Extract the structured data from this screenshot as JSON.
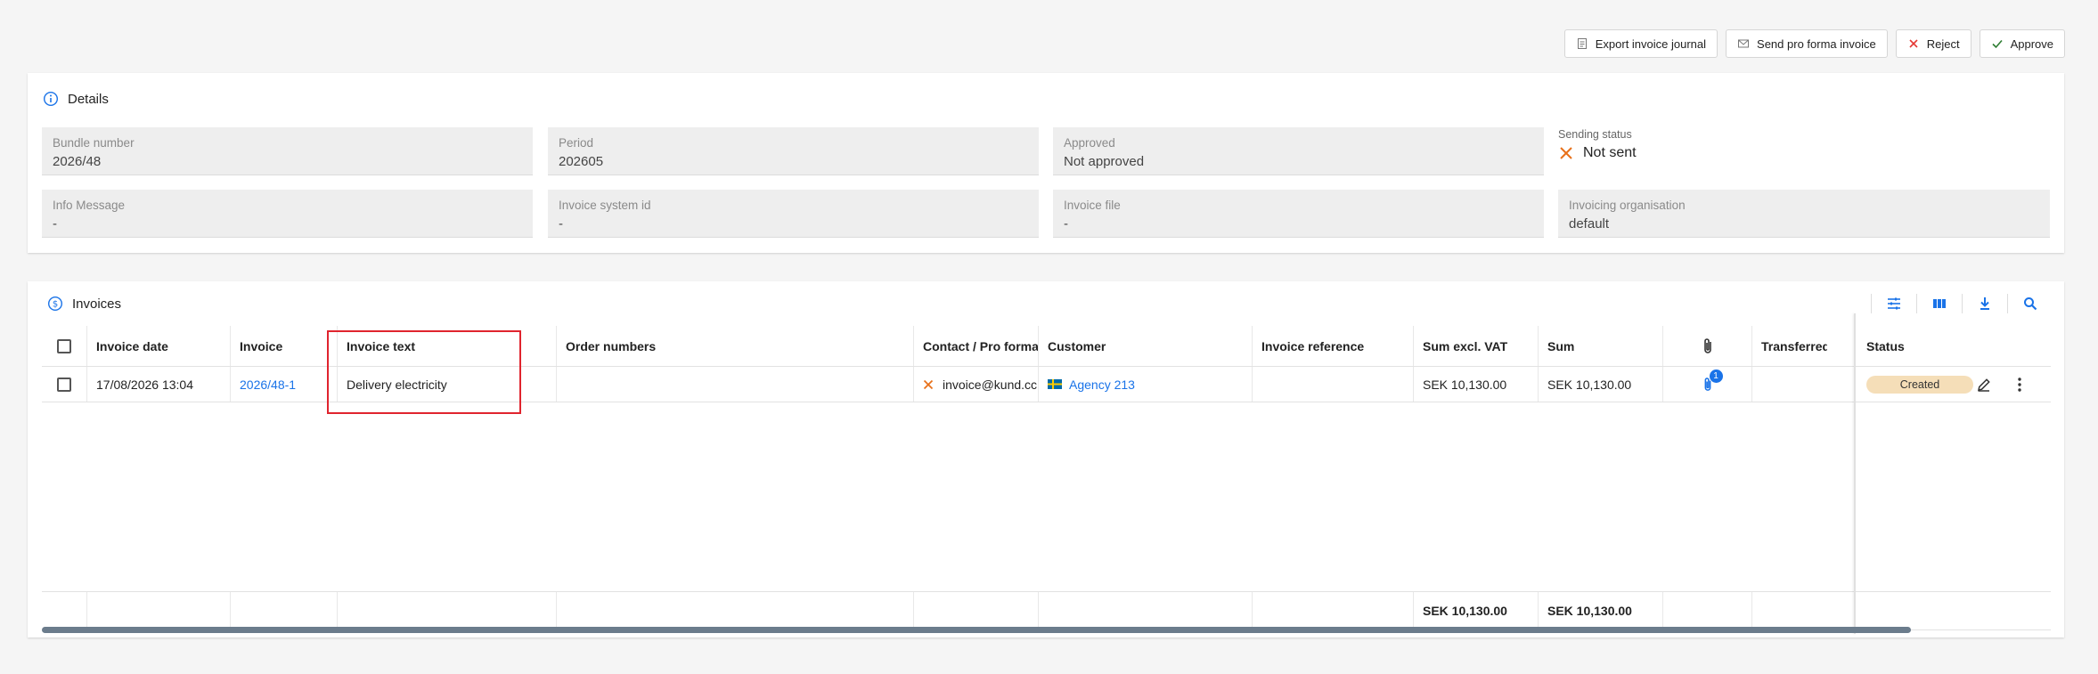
{
  "toolbar": {
    "export_label": "Export invoice journal",
    "proforma_label": "Send pro forma invoice",
    "reject_label": "Reject",
    "approve_label": "Approve"
  },
  "details": {
    "title": "Details",
    "fields": {
      "bundle_number": {
        "label": "Bundle number",
        "value": "2026/48"
      },
      "period": {
        "label": "Period",
        "value": "202605"
      },
      "approved": {
        "label": "Approved",
        "value": "Not approved"
      },
      "info_message": {
        "label": "Info Message",
        "value": "-"
      },
      "invoice_system_id": {
        "label": "Invoice system id",
        "value": "-"
      },
      "invoice_file": {
        "label": "Invoice file",
        "value": "-"
      },
      "invoicing_organisation": {
        "label": "Invoicing organisation",
        "value": "default"
      }
    },
    "sending_status": {
      "label": "Sending status",
      "value": "Not sent"
    }
  },
  "invoices": {
    "title": "Invoices",
    "columns": {
      "invoice_date": "Invoice date",
      "invoice": "Invoice",
      "invoice_text": "Invoice text",
      "order_numbers": "Order numbers",
      "contact": "Contact / Pro forma",
      "customer": "Customer",
      "invoice_reference": "Invoice reference",
      "sum_excl_vat": "Sum excl. VAT",
      "sum": "Sum",
      "transferred": "Transferred",
      "status": "Status"
    },
    "rows": [
      {
        "invoice_date": "17/08/2026 13:04",
        "invoice": "2026/48-1",
        "invoice_text": "Delivery electricity",
        "order_numbers": "",
        "contact": "invoice@kund.cc",
        "customer": "Agency 213",
        "invoice_reference": "",
        "sum_excl_vat": "SEK 10,130.00",
        "sum": "SEK 10,130.00",
        "attachments": "1",
        "transferred": "",
        "status": "Created"
      }
    ],
    "footer": {
      "sum_excl_vat": "SEK 10,130.00",
      "sum": "SEK 10,130.00"
    }
  },
  "colors": {
    "accent": "#1a73e8",
    "reject": "#e53935",
    "warning_x": "#e8711a",
    "status_badge": "#f5deb8",
    "highlight": "#e0242e"
  }
}
